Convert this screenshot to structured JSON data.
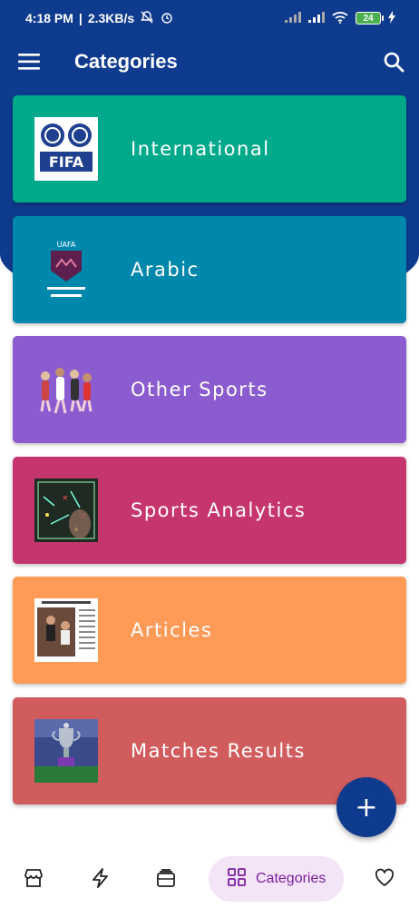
{
  "status_bar": {
    "time": "4:18 PM",
    "net_speed": "2.3KB/s",
    "battery": "24"
  },
  "app_bar": {
    "title": "Categories",
    "menu_icon": "menu-icon",
    "search_icon": "search-icon"
  },
  "colors": {
    "primary": "#0f3b8e",
    "international": "#00a98a",
    "arabic": "#0087ac",
    "other_sports": "#8b5cd0",
    "sports_analytics": "#c5366f",
    "articles": "#ff9a57",
    "matches_results": "#d15c5d",
    "nav_active_bg": "#f3e4f7",
    "nav_active_text": "#7b1fa2"
  },
  "categories": [
    {
      "label": "International",
      "image": "fifa-logo"
    },
    {
      "label": "Arabic",
      "image": "uafa-logo"
    },
    {
      "label": "Other Sports",
      "image": "athletes-collage"
    },
    {
      "label": "Sports Analytics",
      "image": "tactics-board"
    },
    {
      "label": "Articles",
      "image": "newspaper-clipping"
    },
    {
      "label": "Matches Results",
      "image": "premier-league-trophy"
    }
  ],
  "fab": {
    "icon": "plus-icon",
    "label": "+"
  },
  "bottom_nav": {
    "items": [
      {
        "icon": "store-icon"
      },
      {
        "icon": "flash-icon"
      },
      {
        "icon": "ticket-icon"
      },
      {
        "icon": "grid-icon",
        "label": "Categories",
        "active": true
      },
      {
        "icon": "heart-icon"
      }
    ]
  }
}
